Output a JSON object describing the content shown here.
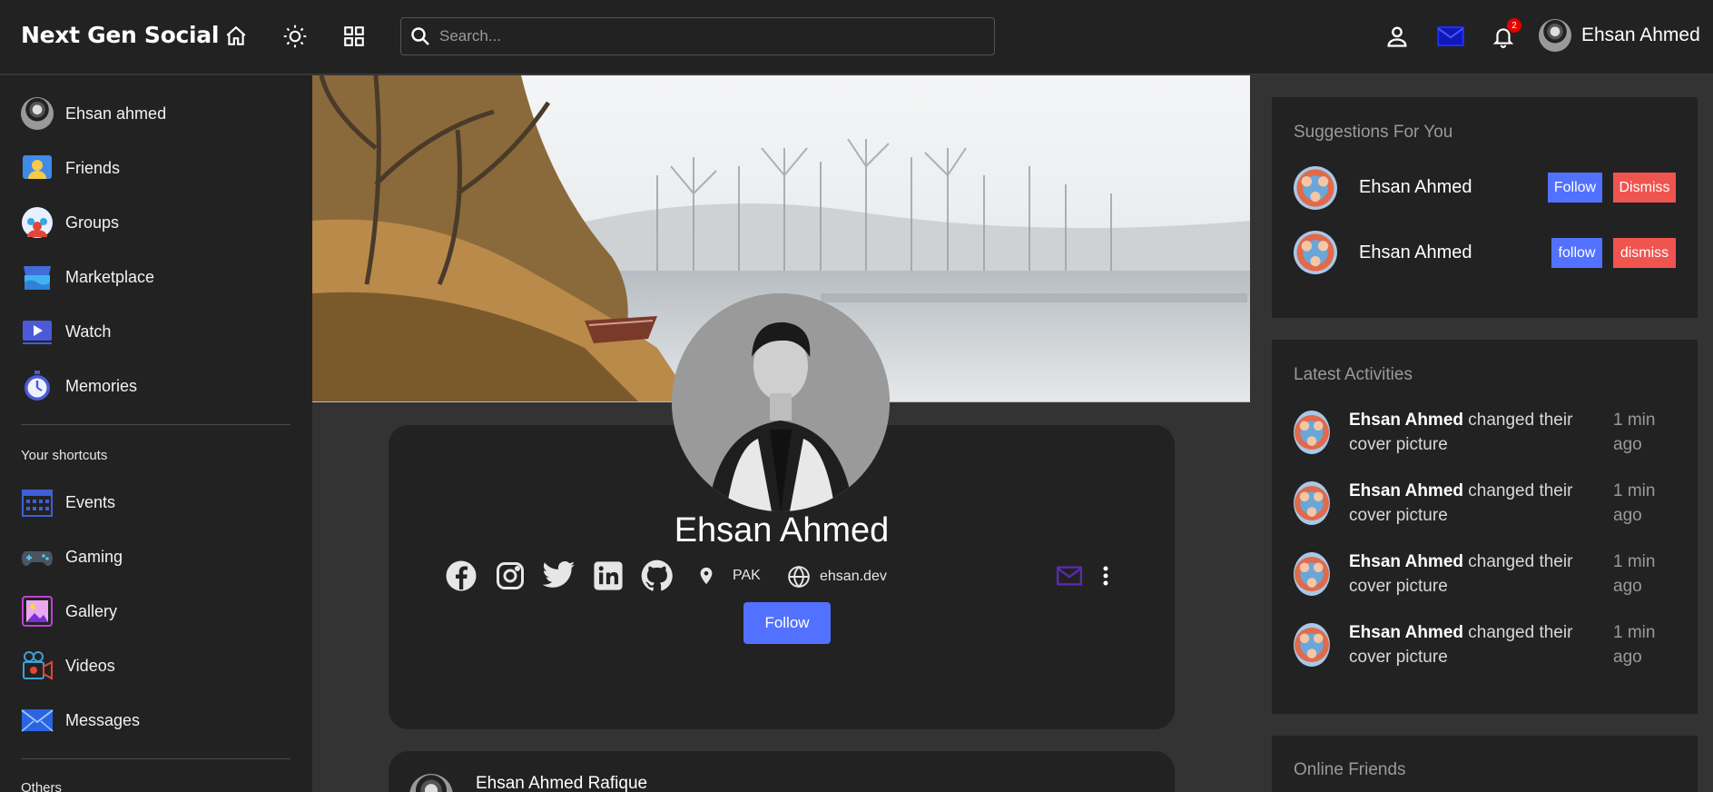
{
  "navbar": {
    "logo": "Next Gen Social",
    "search_placeholder": "Search...",
    "notification_count": "2",
    "user_name": "Ehsan Ahmed",
    "icons": [
      "home-icon",
      "sun-icon",
      "grid-icon",
      "user-icon",
      "mail-icon",
      "bell-icon"
    ]
  },
  "sidebar": {
    "items": [
      {
        "label": "Ehsan ahmed",
        "icon": "avatar"
      },
      {
        "label": "Friends",
        "icon": "friends-icon"
      },
      {
        "label": "Groups",
        "icon": "groups-icon"
      },
      {
        "label": "Marketplace",
        "icon": "store-icon"
      },
      {
        "label": "Watch",
        "icon": "video-play-icon"
      },
      {
        "label": "Memories",
        "icon": "stopwatch-icon"
      }
    ],
    "shortcuts_title": "Your shortcuts",
    "shortcuts": [
      {
        "label": "Events",
        "icon": "calendar-icon"
      },
      {
        "label": "Gaming",
        "icon": "gamepad-icon"
      },
      {
        "label": "Gallery",
        "icon": "gallery-icon"
      },
      {
        "label": "Videos",
        "icon": "camera-icon"
      },
      {
        "label": "Messages",
        "icon": "envelope-icon"
      }
    ],
    "others_title": "Others"
  },
  "profile": {
    "name": "Ehsan Ahmed",
    "location": "PAK",
    "website": "ehsan.dev",
    "follow_label": "Follow",
    "socials": [
      "facebook-icon",
      "instagram-icon",
      "twitter-icon",
      "linkedin-icon",
      "github-icon"
    ]
  },
  "post": {
    "author": "Ehsan Ahmed Rafique"
  },
  "suggestions": {
    "title": "Suggestions For You",
    "items": [
      {
        "name": "Ehsan Ahmed",
        "follow": "Follow",
        "dismiss": "Dismiss"
      },
      {
        "name": "Ehsan Ahmed",
        "follow": "follow",
        "dismiss": "dismiss"
      }
    ]
  },
  "activities": {
    "title": "Latest Activities",
    "items": [
      {
        "user": "Ehsan Ahmed",
        "action": "changed their cover picture",
        "time": "1 min ago"
      },
      {
        "user": "Ehsan Ahmed",
        "action": "changed their cover picture",
        "time": "1 min ago"
      },
      {
        "user": "Ehsan Ahmed",
        "action": "changed their cover picture",
        "time": "1 min ago"
      },
      {
        "user": "Ehsan Ahmed",
        "action": "changed their cover picture",
        "time": "1 min ago"
      }
    ]
  },
  "online_friends": {
    "title": "Online Friends"
  },
  "colors": {
    "accent": "#5271ff",
    "dismiss": "#f0544f",
    "panel": "#222222",
    "background": "#333333"
  }
}
